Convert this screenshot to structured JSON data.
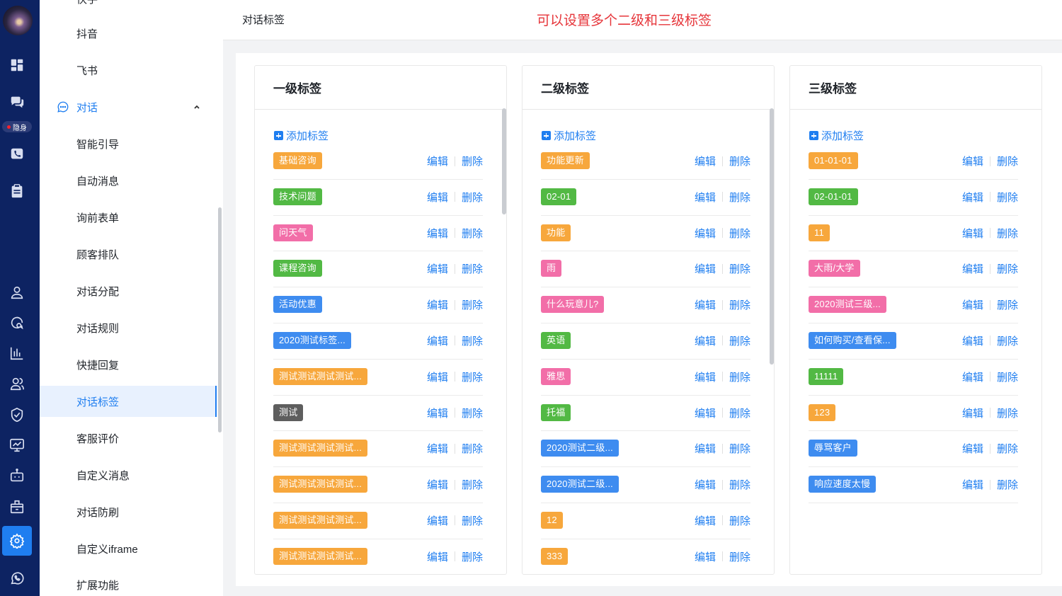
{
  "rail": {
    "badge": "隐身",
    "icons": [
      "dashboard-icon",
      "chat-bubbles-icon",
      "phone-icon",
      "clipboard-icon",
      "user-icon",
      "message-search-icon",
      "bar-chart-icon",
      "users-icon",
      "shield-check-icon",
      "monitor-chart-icon",
      "robot-icon",
      "package-icon",
      "settings-gear-icon",
      "whatsapp-icon"
    ],
    "active_icon": "settings-gear-icon"
  },
  "submenu": {
    "items_top": [
      "抖音",
      "飞书"
    ],
    "group": "对话",
    "items": [
      "智能引导",
      "自动消息",
      "询前表单",
      "顾客排队",
      "对话分配",
      "对话规则",
      "快捷回复",
      "对话标签",
      "客服评价",
      "自定义消息",
      "对话防刷",
      "自定义iframe",
      "扩展功能"
    ],
    "active": "对话标签",
    "cut_top": "快手"
  },
  "header": {
    "title": "对话标签",
    "note": "可以设置多个二级和三级标签"
  },
  "actions": {
    "edit": "编辑",
    "delete": "删除"
  },
  "columns": [
    {
      "title": "一级标签",
      "add_label": "添加标签",
      "tags": [
        {
          "text": "基础咨询",
          "color": "orange"
        },
        {
          "text": "技术问题",
          "color": "green"
        },
        {
          "text": "问天气",
          "color": "pink"
        },
        {
          "text": "课程咨询",
          "color": "green"
        },
        {
          "text": "活动优惠",
          "color": "blue"
        },
        {
          "text": "2020测试标签...",
          "color": "blue"
        },
        {
          "text": "测试测试测试测试...",
          "color": "orange"
        },
        {
          "text": "测试",
          "color": "gray"
        },
        {
          "text": "测试测试测试测试...",
          "color": "orange"
        },
        {
          "text": "测试测试测试测试...",
          "color": "orange"
        },
        {
          "text": "测试测试测试测试...",
          "color": "orange"
        },
        {
          "text": "测试测试测试测试...",
          "color": "orange"
        }
      ]
    },
    {
      "title": "二级标签",
      "add_label": "添加标签",
      "tags": [
        {
          "text": "功能更新",
          "color": "orange"
        },
        {
          "text": "02-01",
          "color": "green"
        },
        {
          "text": "功能",
          "color": "orange"
        },
        {
          "text": "雨",
          "color": "pink"
        },
        {
          "text": "什么玩意儿?",
          "color": "pink"
        },
        {
          "text": "英语",
          "color": "green"
        },
        {
          "text": "雅思",
          "color": "pink"
        },
        {
          "text": "托福",
          "color": "green"
        },
        {
          "text": "2020测试二级...",
          "color": "blue"
        },
        {
          "text": "2020测试二级...",
          "color": "blue"
        },
        {
          "text": "12",
          "color": "orange"
        },
        {
          "text": "333",
          "color": "orange"
        }
      ]
    },
    {
      "title": "三级标签",
      "add_label": "添加标签",
      "tags": [
        {
          "text": "01-01-01",
          "color": "orange"
        },
        {
          "text": "02-01-01",
          "color": "green"
        },
        {
          "text": "11",
          "color": "orange"
        },
        {
          "text": "大雨/大学",
          "color": "pink"
        },
        {
          "text": "2020测试三级...",
          "color": "pink"
        },
        {
          "text": "如何购买/查看保...",
          "color": "blue"
        },
        {
          "text": "11111",
          "color": "green"
        },
        {
          "text": "123",
          "color": "orange"
        },
        {
          "text": "辱骂客户",
          "color": "blue"
        },
        {
          "text": "响应速度太慢",
          "color": "blue"
        }
      ]
    }
  ]
}
